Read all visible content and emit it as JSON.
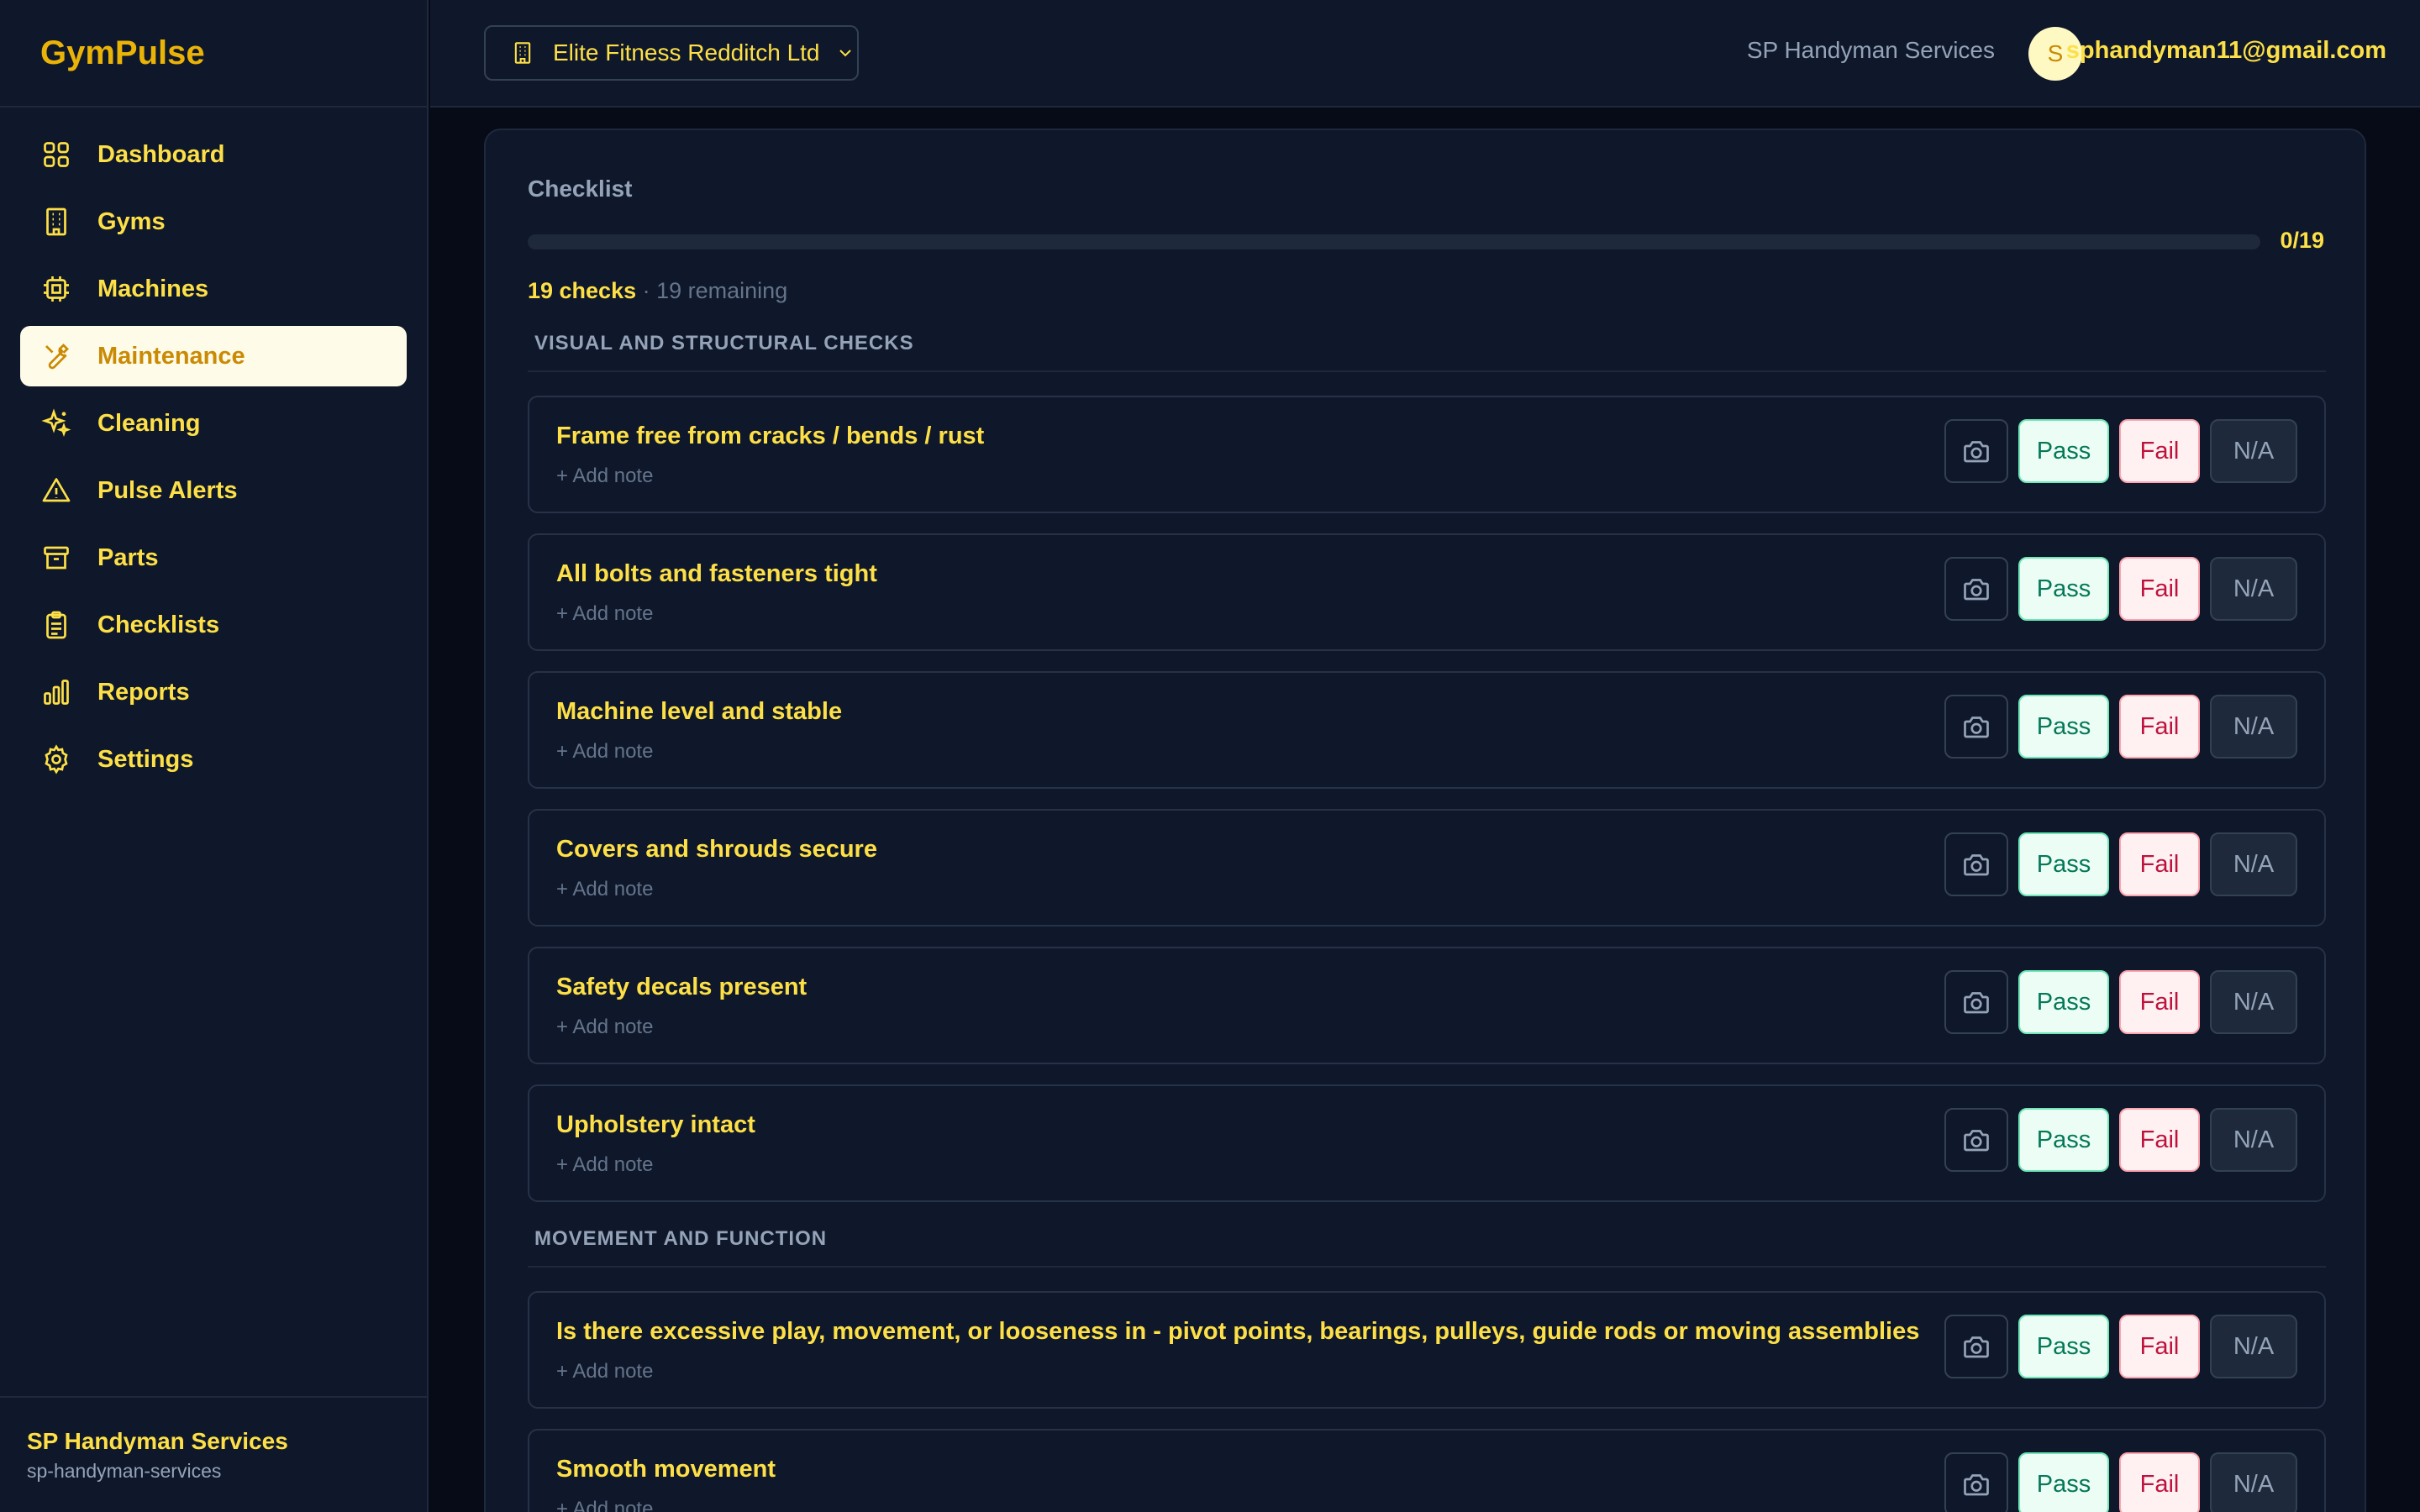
{
  "app": {
    "name": "GymPulse"
  },
  "sidebar": {
    "items": [
      {
        "label": "Dashboard",
        "icon": "dashboard-icon"
      },
      {
        "label": "Gyms",
        "icon": "building-icon"
      },
      {
        "label": "Machines",
        "icon": "cpu-icon"
      },
      {
        "label": "Maintenance",
        "icon": "wrench-icon",
        "active": true
      },
      {
        "label": "Cleaning",
        "icon": "sparkles-icon"
      },
      {
        "label": "Pulse Alerts",
        "icon": "alert-triangle-icon"
      },
      {
        "label": "Parts",
        "icon": "archive-icon"
      },
      {
        "label": "Checklists",
        "icon": "clipboard-icon"
      },
      {
        "label": "Reports",
        "icon": "bar-chart-icon"
      },
      {
        "label": "Settings",
        "icon": "gear-icon"
      }
    ],
    "footer": {
      "org_name": "SP Handyman Services",
      "org_slug": "sp-handyman-services"
    }
  },
  "topbar": {
    "gym_selector": "Elite Fitness Redditch Ltd",
    "org_name": "SP Handyman Services",
    "avatar_initial": "S",
    "email": "sphandyman11@gmail.com"
  },
  "checklist": {
    "title": "Checklist",
    "progress_label": "0/19",
    "progress_fraction": 0,
    "checks_label": "19 checks",
    "remaining_label": "· 19 remaining",
    "add_note": "+ Add note",
    "buttons": {
      "pass": "Pass",
      "fail": "Fail",
      "na": "N/A"
    },
    "sections": [
      {
        "title": "VISUAL AND STRUCTURAL CHECKS",
        "items": [
          "Frame free from cracks / bends / rust",
          "All bolts and fasteners tight",
          "Machine level and stable",
          "Covers and shrouds secure",
          "Safety decals present",
          "Upholstery intact"
        ]
      },
      {
        "title": "MOVEMENT AND FUNCTION",
        "items": [
          "Is there excessive play, movement, or looseness in - pivot points, bearings, pulleys, guide rods or moving assemblies",
          "Smooth movement"
        ]
      }
    ]
  },
  "colors": {
    "accent": "#eab308",
    "text_yellow": "#fde047",
    "background": "#0f172a",
    "pass": "#047857",
    "fail": "#be123c"
  }
}
